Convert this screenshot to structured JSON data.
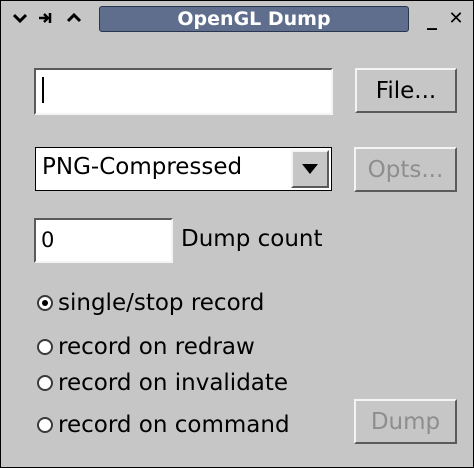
{
  "window": {
    "title": "OpenGL Dump",
    "menu_icon": "chevron-down-icon",
    "pin_icon": "pin-icon",
    "shade_icon": "chevron-up-icon",
    "minimize_label": "_",
    "close_label": "✕"
  },
  "file": {
    "path_value": "",
    "file_button_label": "File..."
  },
  "format": {
    "selected": "PNG-Compressed",
    "opts_button_label": "Opts..."
  },
  "dump_count": {
    "value": "0",
    "label": "Dump count"
  },
  "record_modes": [
    {
      "label": "single/stop record",
      "selected": true
    },
    {
      "label": "record on redraw",
      "selected": false
    },
    {
      "label": "record on invalidate",
      "selected": false
    },
    {
      "label": "record on command",
      "selected": false
    }
  ],
  "dump_button_label": "Dump",
  "colors": {
    "background": "#c6c6c6",
    "title_bar": "#5f6e8c",
    "disabled_text": "#8e8e8e"
  }
}
